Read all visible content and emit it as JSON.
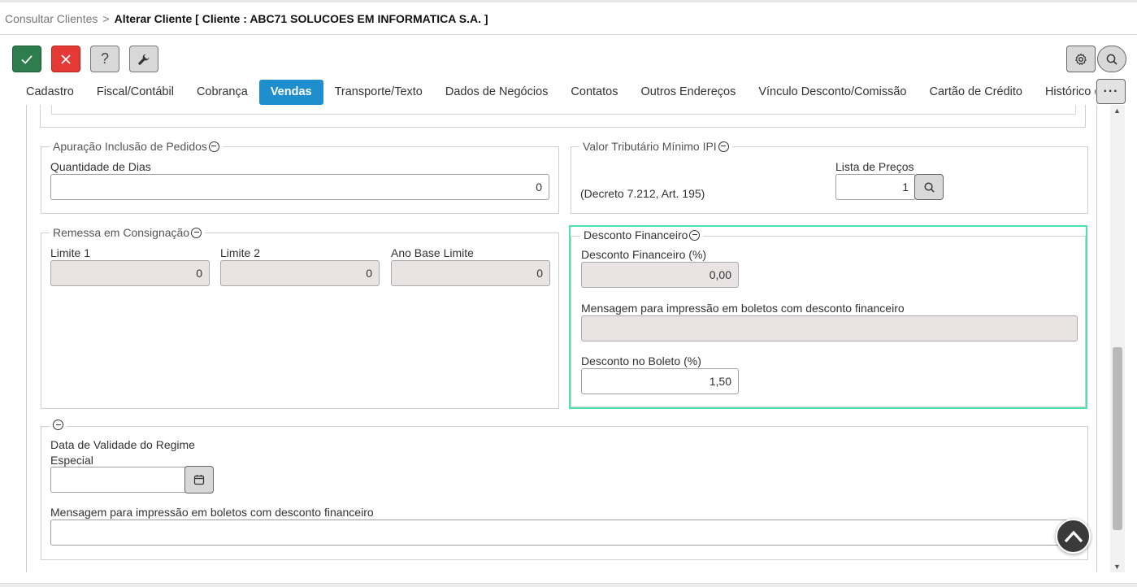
{
  "breadcrumb": {
    "parent": "Consultar Clientes",
    "separator": ">",
    "current": "Alterar Cliente [ Cliente : ABC71 SOLUCOES EM INFORMATICA S.A. ]"
  },
  "toolbar": {
    "confirm_icon": "check-icon",
    "cancel_icon": "close-icon",
    "help_label": "?",
    "tools_icon": "wrench-icon",
    "settings_icon": "gear-icon",
    "search_icon": "search-icon"
  },
  "tabs": [
    {
      "label": "Cadastro",
      "active": false
    },
    {
      "label": "Fiscal/Contábil",
      "active": false
    },
    {
      "label": "Cobrança",
      "active": false
    },
    {
      "label": "Vendas",
      "active": true
    },
    {
      "label": "Transporte/Texto",
      "active": false
    },
    {
      "label": "Dados de Negócios",
      "active": false
    },
    {
      "label": "Contatos",
      "active": false
    },
    {
      "label": "Outros Endereços",
      "active": false
    },
    {
      "label": "Vínculo Desconto/Comissão",
      "active": false
    },
    {
      "label": "Cartão de Crédito",
      "active": false
    },
    {
      "label": "Histórico de A",
      "active": false
    }
  ],
  "more_label": "···",
  "apuracao": {
    "legend": "Apuração Inclusão de Pedidos",
    "dias_label": "Quantidade de Dias",
    "dias_value": "0"
  },
  "valor_tributario": {
    "legend": "Valor Tributário Mínimo IPI",
    "decreto": "(Decreto 7.212, Art. 195)",
    "lista_label": "Lista de Preços",
    "lista_value": "1"
  },
  "remessa": {
    "legend": "Remessa em Consignação",
    "limite1_label": "Limite 1",
    "limite1_value": "0",
    "limite2_label": "Limite 2",
    "limite2_value": "0",
    "ano_label": "Ano Base Limite",
    "ano_value": "0"
  },
  "desconto": {
    "legend": "Desconto Financeiro",
    "percent_label": "Desconto Financeiro (%)",
    "percent_value": "0,00",
    "mensagem_label": "Mensagem para impressão em boletos com desconto financeiro",
    "mensagem_value": "",
    "boleto_label": "Desconto no Boleto (%)",
    "boleto_value": "1,50"
  },
  "regime": {
    "validade_label_1": "Data de Validade do Regime",
    "validade_label_2": "Especial",
    "validade_value": "",
    "mensagem_label": "Mensagem para impressão em boletos com desconto financeiro",
    "mensagem_value": ""
  },
  "colors": {
    "accent": "#1f8ecf",
    "confirm": "#2e7d4f",
    "cancel": "#e53935",
    "highlight": "#4fe0b5"
  }
}
